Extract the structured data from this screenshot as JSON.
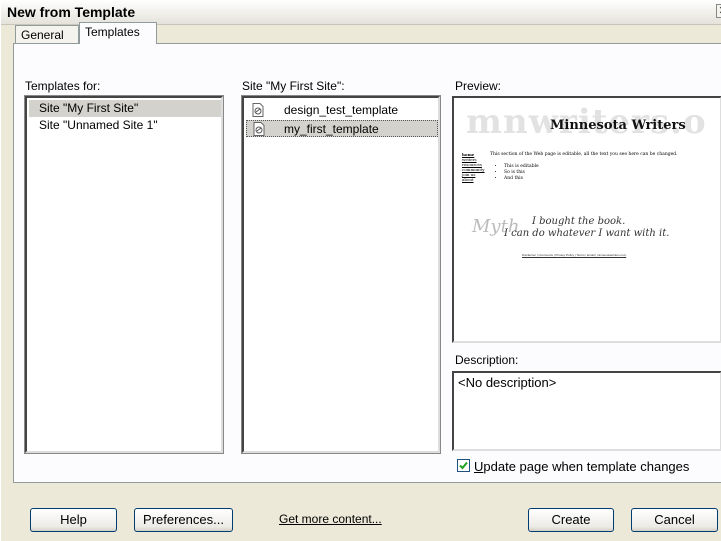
{
  "window": {
    "title": "New from Template"
  },
  "tabs": [
    {
      "label": "General"
    },
    {
      "label": "Templates"
    }
  ],
  "templates_for": {
    "label": "Templates for:",
    "items": [
      {
        "label": "Site \"My First Site\"",
        "selected": true
      },
      {
        "label": "Site \"Unnamed Site 1\"",
        "selected": false
      }
    ]
  },
  "site_list": {
    "label": "Site \"My First Site\":",
    "items": [
      {
        "label": "design_test_template",
        "icon": "template-file-icon",
        "selected": false
      },
      {
        "label": "my_first_template",
        "icon": "template-file-icon",
        "selected": true
      }
    ]
  },
  "preview": {
    "label": "Preview:",
    "watermark": "mnwriters.o",
    "heading": "Minnesota Writers",
    "nav": [
      "home",
      "writers",
      "resources",
      "community",
      "join us",
      "about"
    ],
    "body_text": "This section of the Web page is editable, all the text you see here can be changed.",
    "bullets": [
      "This is editable",
      "So is this",
      "And this"
    ],
    "script_word": "Myth",
    "quote_line1": "I bought the book.",
    "quote_line2": "I can do whatever I want with it.",
    "footer_links": "Disclaimer | Comments | Privacy Policy | Terms | Email | minnesotawriters.com"
  },
  "description": {
    "label": "Description:",
    "value": "<No description>"
  },
  "update_checkbox": {
    "label_accel": "U",
    "label_rest": "pdate page when template changes",
    "checked": true
  },
  "buttons": {
    "help": "Help",
    "preferences": "Preferences...",
    "get_more": "Get more content...",
    "create": "Create",
    "cancel": "Cancel"
  }
}
